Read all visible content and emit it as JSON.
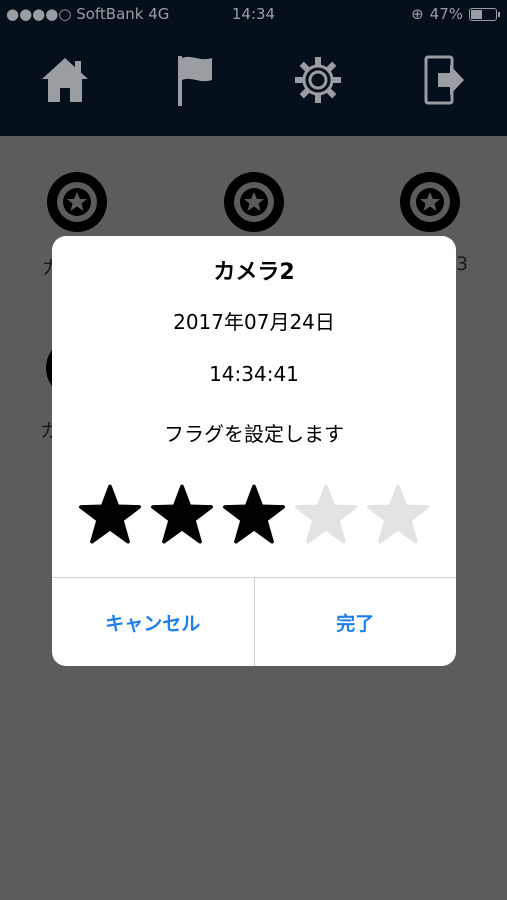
{
  "status_bar": {
    "carrier": "●●●●○ SoftBank  4G",
    "time": "14:34",
    "battery_text": "47%",
    "battery_level": 0.47
  },
  "nav": {
    "icons": [
      "home-icon",
      "flag-icon",
      "gear-icon",
      "logout-icon"
    ]
  },
  "background": {
    "labels": [
      "カ",
      "3",
      "カ"
    ]
  },
  "dialog": {
    "title": "カメラ2",
    "date": "2017年07月24日",
    "time": "14:34:41",
    "message": "フラグを設定します",
    "rating": 3,
    "max_rating": 5,
    "cancel_label": "キャンセル",
    "done_label": "完了"
  },
  "colors": {
    "nav_bg": "#05101b",
    "overlay_bg": "#5c5c5c",
    "accent": "#1e7fe8",
    "star_on": "#000000",
    "star_off": "#e3e3e3"
  }
}
